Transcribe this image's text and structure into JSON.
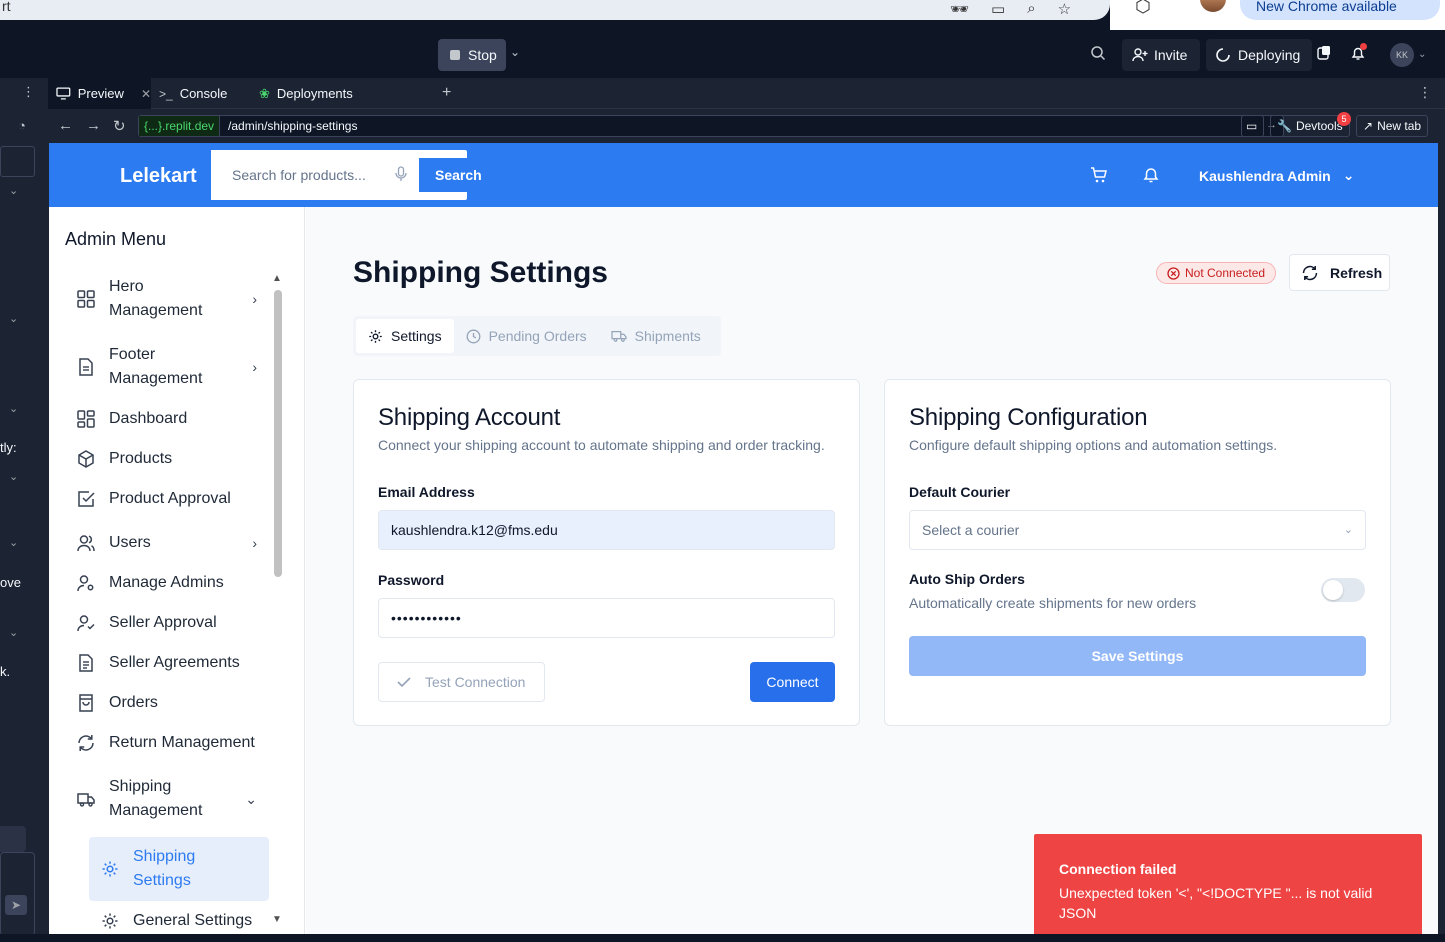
{
  "browser": {
    "url_fragment": "rt",
    "new_chrome_label": "New Chrome available"
  },
  "replit": {
    "stop_label": "Stop",
    "invite_label": "Invite",
    "deploying_label": "Deploying",
    "avatar_initials": "KK",
    "tabs": [
      {
        "label": "Preview"
      },
      {
        "label": "Console"
      },
      {
        "label": "Deployments"
      }
    ],
    "url_domain": "{...}.replit.dev",
    "url_path": "/admin/shipping-settings",
    "devtools_label": "Devtools",
    "devtools_badge": "5",
    "new_tab_label": "New tab",
    "rail_snippets": [
      "tly:",
      "ove",
      "k."
    ]
  },
  "header": {
    "brand": "Lelekart",
    "search_placeholder": "Search for products...",
    "search_button": "Search",
    "user_name": "Kaushlendra Admin"
  },
  "sidebar": {
    "title": "Admin Menu",
    "items": [
      {
        "label": "Hero Management",
        "icon": "grid-icon"
      },
      {
        "label": "Footer Management",
        "icon": "file-icon"
      },
      {
        "label": "Dashboard",
        "icon": "grid-icon"
      },
      {
        "label": "Products",
        "icon": "package-icon"
      },
      {
        "label": "Product Approval",
        "icon": "check-square-icon"
      },
      {
        "label": "Users",
        "icon": "users-icon"
      },
      {
        "label": "Manage Admins",
        "icon": "user-cog-icon"
      },
      {
        "label": "Seller Approval",
        "icon": "user-check-icon"
      },
      {
        "label": "Seller Agreements",
        "icon": "file-text-icon"
      },
      {
        "label": "Orders",
        "icon": "shopping-bag-icon"
      },
      {
        "label": "Return Management",
        "icon": "refresh-icon"
      },
      {
        "label": "Shipping Management",
        "icon": "truck-icon"
      },
      {
        "label": "Shipping Settings",
        "icon": "gear-icon"
      },
      {
        "label": "General Settings",
        "icon": "gear-icon"
      }
    ]
  },
  "page": {
    "title": "Shipping Settings",
    "status": "Not Connected",
    "refresh_label": "Refresh",
    "tabs": [
      {
        "label": "Settings"
      },
      {
        "label": "Pending Orders"
      },
      {
        "label": "Shipments"
      }
    ]
  },
  "account_card": {
    "title": "Shipping Account",
    "description": "Connect your shipping account to automate shipping and order tracking.",
    "email_label": "Email Address",
    "email_value": "kaushlendra.k12@fms.edu",
    "password_label": "Password",
    "password_value": "••••••••••••",
    "test_button": "Test Connection",
    "connect_button": "Connect"
  },
  "config_card": {
    "title": "Shipping Configuration",
    "description": "Configure default shipping options and automation settings.",
    "courier_label": "Default Courier",
    "courier_placeholder": "Select a courier",
    "auto_ship_label": "Auto Ship Orders",
    "auto_ship_desc": "Automatically create shipments for new orders",
    "auto_ship_enabled": false,
    "save_button": "Save Settings"
  },
  "toast": {
    "title": "Connection failed",
    "message": "Unexpected token '<', \"<!DOCTYPE \"... is not valid JSON"
  },
  "colors": {
    "brand_blue": "#2d7bf0",
    "error_red": "#ef4444",
    "ide_dark": "#0e1525"
  }
}
